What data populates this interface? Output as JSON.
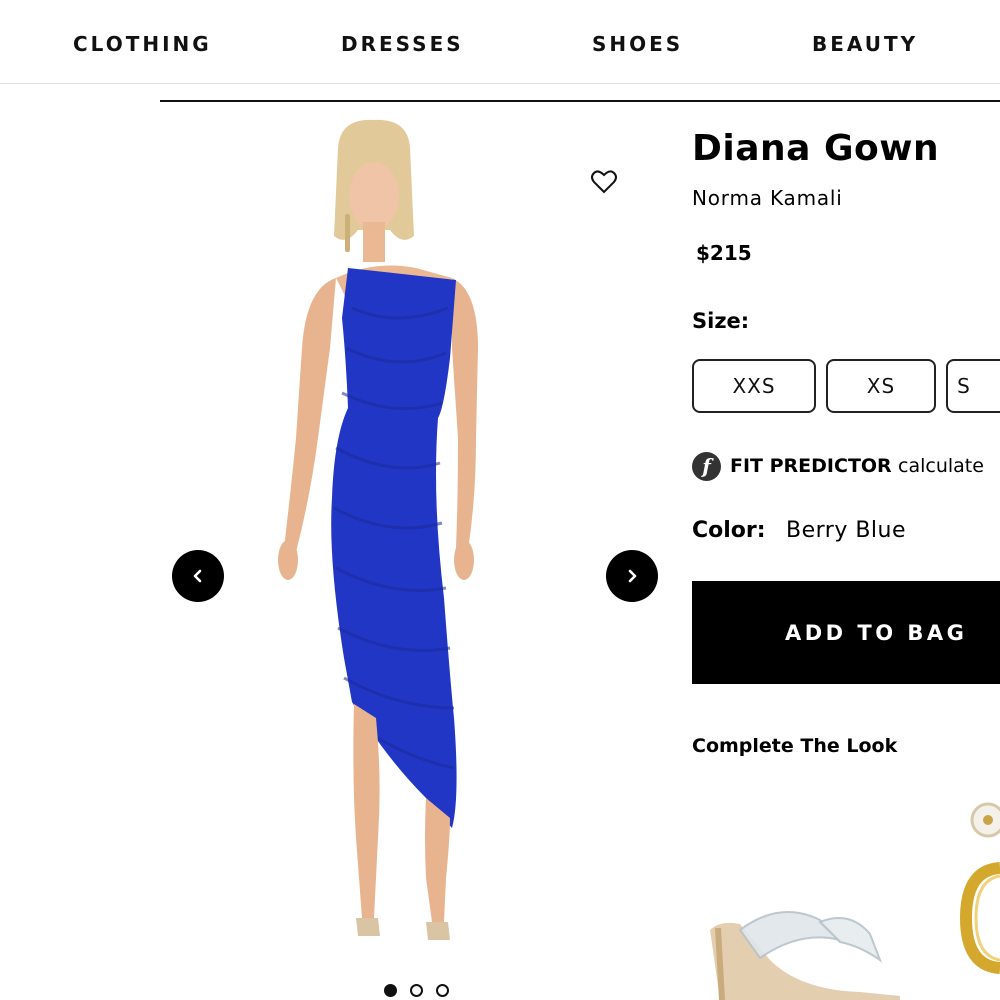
{
  "nav": {
    "items": [
      {
        "label": "CLOTHING"
      },
      {
        "label": "DRESSES"
      },
      {
        "label": "SHOES"
      },
      {
        "label": "BEAUTY"
      }
    ]
  },
  "gallery": {
    "image_icon": "product-photo-model-in-blue-gown",
    "wishlist_icon": "heart-outline-icon",
    "prev_icon": "chevron-left-icon",
    "next_icon": "chevron-right-icon",
    "dots": [
      {
        "active": true
      },
      {
        "active": false
      },
      {
        "active": false
      }
    ]
  },
  "product": {
    "title": "Diana Gown",
    "brand": "Norma Kamali",
    "price": "$215",
    "dress_color_hex": "#2136c4"
  },
  "size": {
    "label": "Size:",
    "options": [
      {
        "label": "XXS"
      },
      {
        "label": "XS"
      },
      {
        "label": "S"
      }
    ]
  },
  "fit_predictor": {
    "icon": "fit-predictor-logo-icon",
    "logo_letter": "f",
    "name": "FIT PREDICTOR",
    "text": "calculate"
  },
  "color": {
    "label": "Color:",
    "value": "Berry Blue"
  },
  "cta": {
    "label": "ADD TO BAG",
    "background": "#000000",
    "text_color": "#ffffff"
  },
  "complete_look": {
    "heading": "Complete The Look",
    "items": [
      {
        "icon": "clear-strap-sandal-icon"
      },
      {
        "icon": "gold-hoop-earrings-icon"
      }
    ]
  }
}
